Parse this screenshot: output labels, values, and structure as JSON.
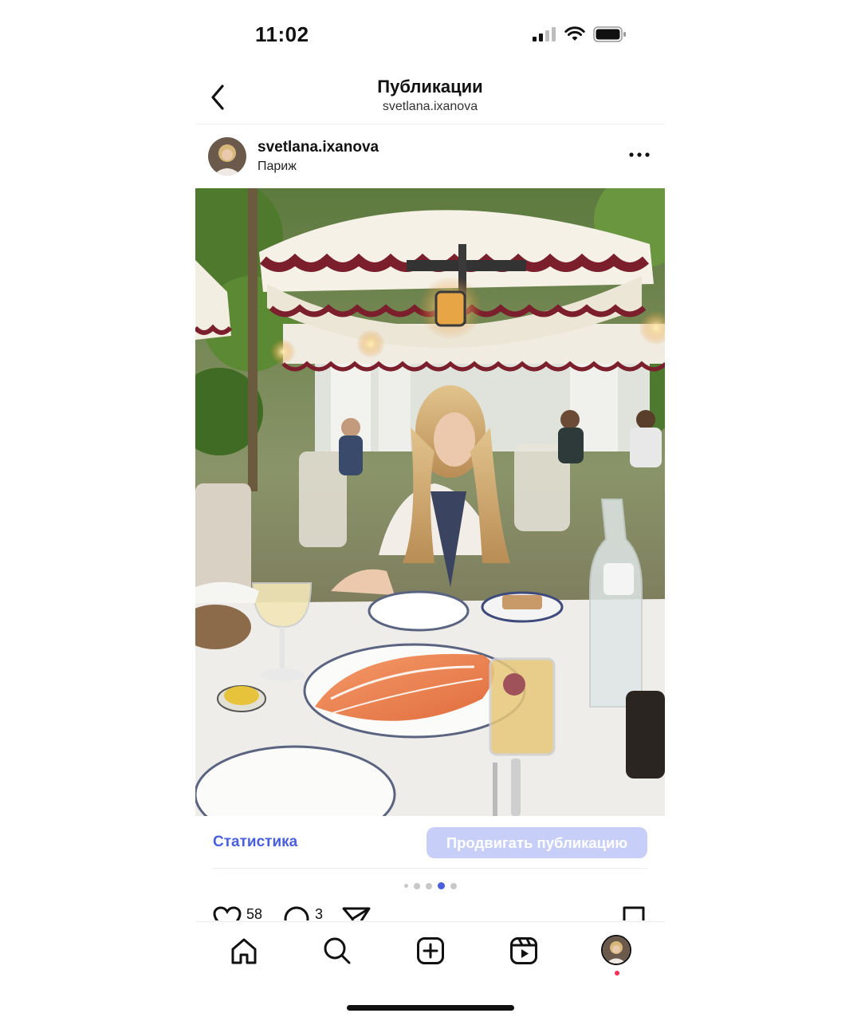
{
  "status_bar": {
    "time": "11:02",
    "icons": [
      "signal-icon",
      "wifi-icon",
      "battery-icon"
    ]
  },
  "header": {
    "title": "Публикации",
    "subtitle": "svetlana.ixanova",
    "back_icon": "chevron-left-icon"
  },
  "post": {
    "username": "svetlana.ixanova",
    "location": "Париж",
    "more_icon": "more-horizontal-icon",
    "photo_alt": "Photo of a woman at a garden restaurant table under umbrellas with salmon and drinks"
  },
  "actions": {
    "stats_label": "Статистика",
    "promote_label": "Продвигать публикацию",
    "likes": "58",
    "comments": "3",
    "carousel": {
      "count": 5,
      "active_index": 3
    }
  },
  "tab_bar": {
    "items": [
      "home-icon",
      "search-icon",
      "create-icon",
      "reels-icon",
      "profile-avatar"
    ],
    "has_notification": true
  },
  "colors": {
    "accent": "#4a5ee0",
    "promote_bg": "#c7cff8",
    "notification": "#ff2d55"
  }
}
